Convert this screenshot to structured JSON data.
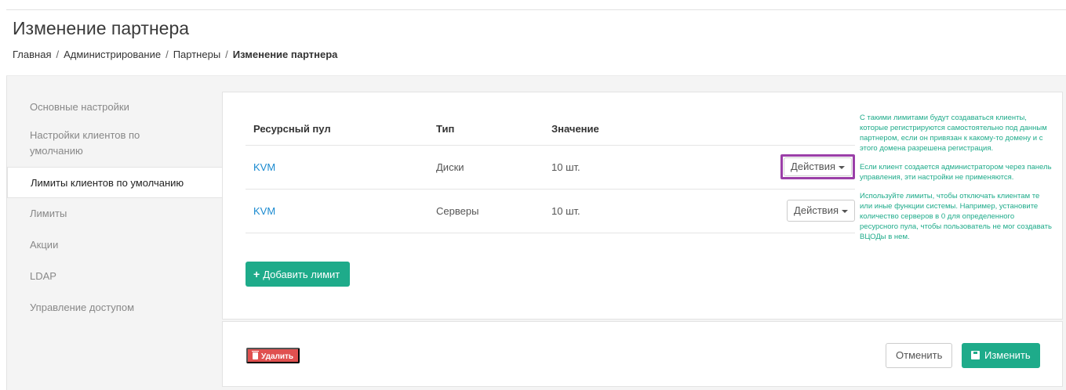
{
  "header": {
    "title": "Изменение партнера",
    "breadcrumb": [
      "Главная",
      "Администрирование",
      "Партнеры",
      "Изменение партнера"
    ]
  },
  "sidebar": {
    "items": [
      {
        "label": "Основные настройки",
        "active": false
      },
      {
        "label": "Настройки клиентов по умолчанию",
        "active": false
      },
      {
        "label": "Лимиты клиентов по умолчанию",
        "active": true
      },
      {
        "label": "Лимиты",
        "active": false
      },
      {
        "label": "Акции",
        "active": false
      },
      {
        "label": "LDAP",
        "active": false
      },
      {
        "label": "Управление доступом",
        "active": false
      }
    ]
  },
  "table": {
    "headers": [
      "Ресурсный пул",
      "Тип",
      "Значение"
    ],
    "rows": [
      {
        "pool": "KVM",
        "type": "Диски",
        "value": "10 шт.",
        "actions": "Действия",
        "highlighted": true
      },
      {
        "pool": "KVM",
        "type": "Серверы",
        "value": "10 шт.",
        "actions": "Действия",
        "highlighted": false
      }
    ]
  },
  "add_button": "Добавить лимит",
  "hint": [
    "С такими лимитами будут создаваться клиенты, которые регистрируются самостоятельно под данным партнером, если он привязан к какому-то домену и с этого домена разрешена регистрация.",
    "Если клиент создается администратором через панель управления, эти настройки не применяются.",
    "Используйте лимиты, чтобы отключать клиентам те или иные функции системы. Например, установите количество серверов в 0 для определенного ресурсного пула, чтобы пользователь не мог создавать ВЦОДы в нем."
  ],
  "footer": {
    "delete_label": "Удалить",
    "cancel_label": "Отменить",
    "save_label": "Изменить"
  },
  "colors": {
    "accent": "#1eab8a",
    "link": "#1a8ad0",
    "danger": "#e0504f",
    "highlight": "#9b3fa8"
  },
  "icons": {
    "add": "plus-icon",
    "delete": "trash-icon",
    "save": "floppy-disk-icon",
    "dropdown": "caret-down-icon"
  }
}
